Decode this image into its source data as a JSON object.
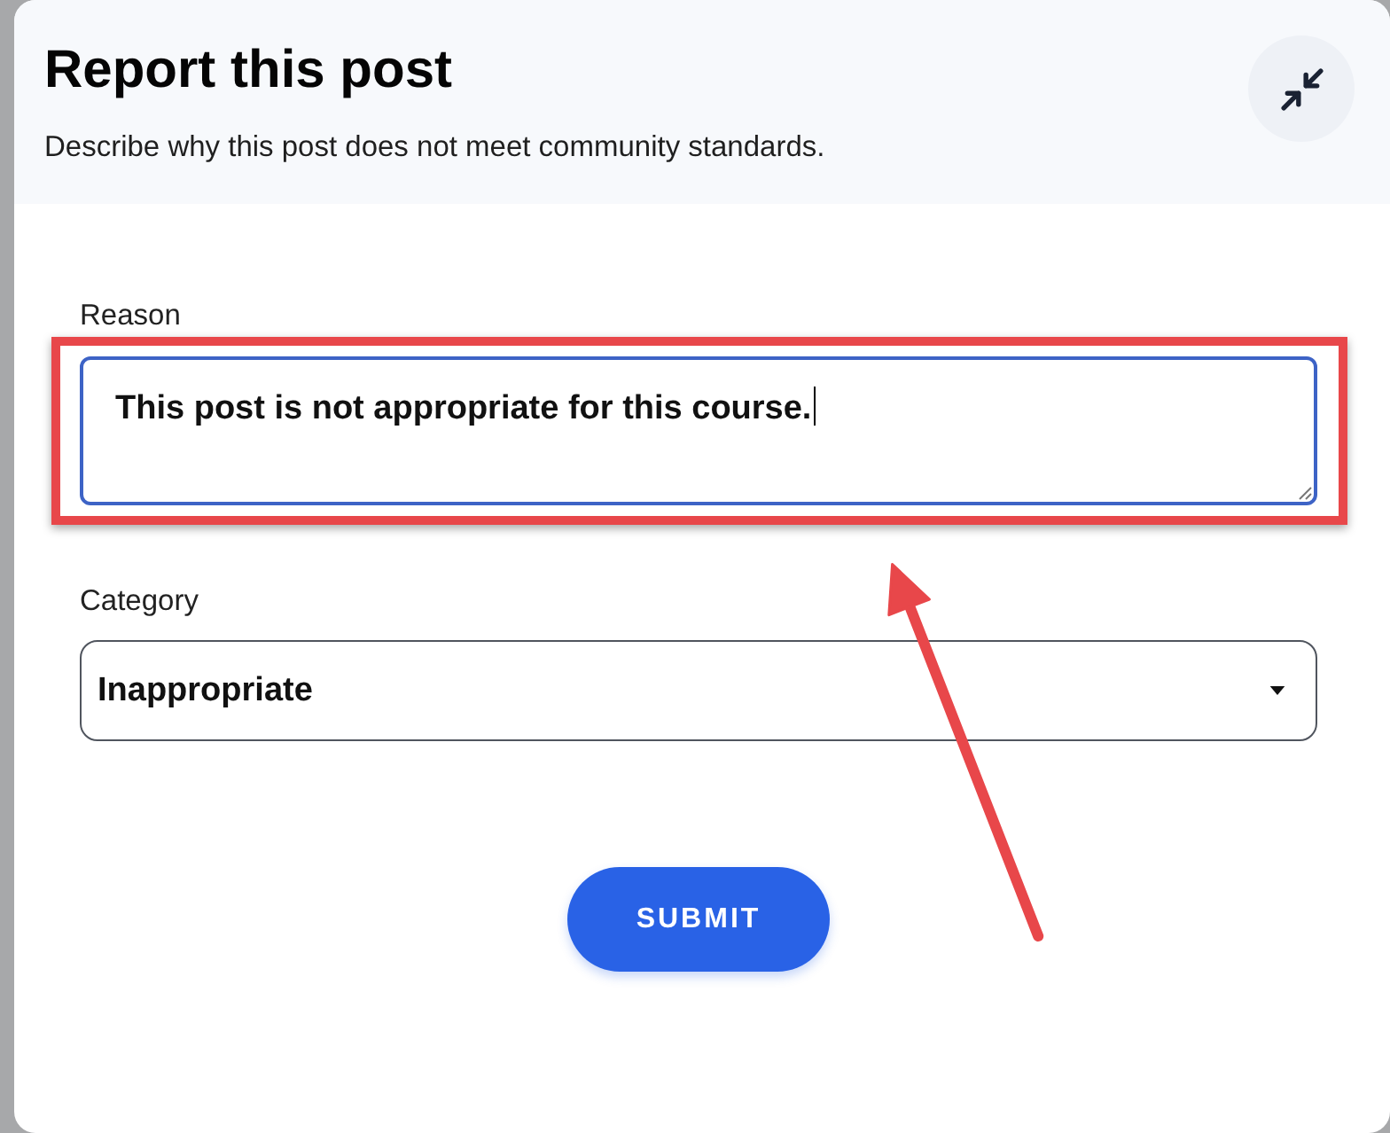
{
  "dialog": {
    "title": "Report this post",
    "subtitle": "Describe why this post does not meet community standards."
  },
  "fields": [
    {
      "kind": "textarea",
      "label": "Reason",
      "value": "This post is not appropriate for this course.",
      "focused": true,
      "highlighted": true
    },
    {
      "kind": "select",
      "label": "Category",
      "value": "Inappropriate",
      "focused": false,
      "highlighted": false
    }
  ],
  "submit_button": {
    "label": "SUBMIT"
  },
  "callout_arrow": true
}
